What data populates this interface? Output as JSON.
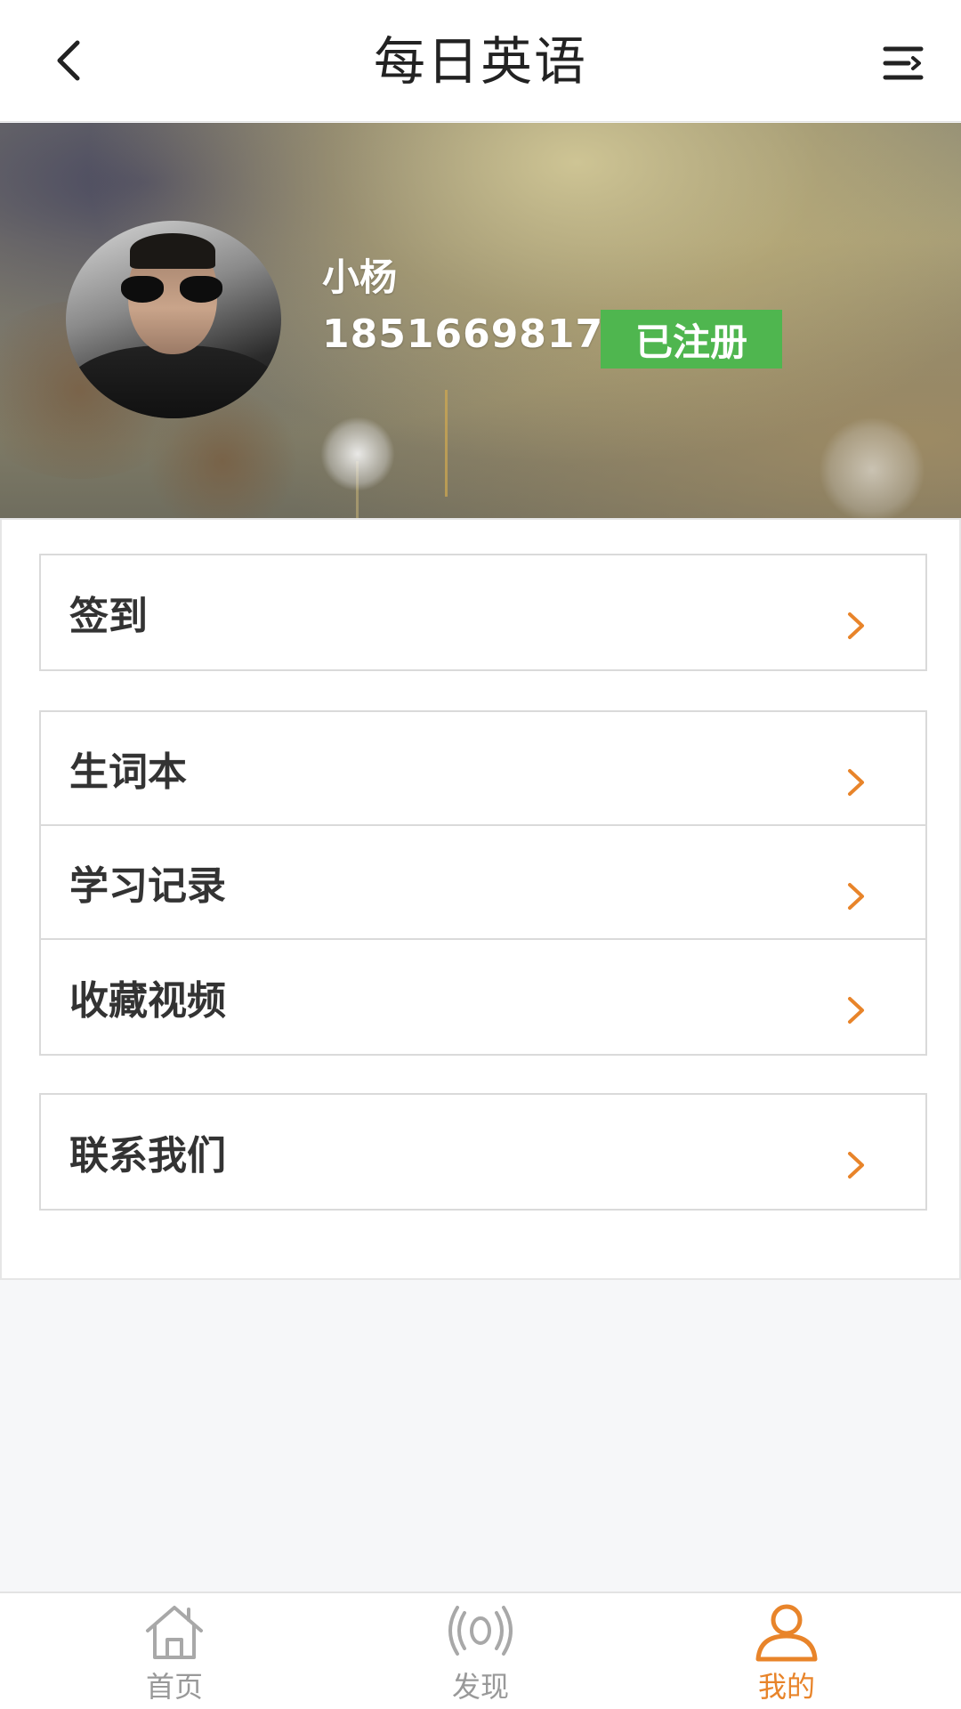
{
  "header": {
    "title": "每日英语",
    "back_icon": "chevron-left-icon",
    "menu_icon": "menu-icon"
  },
  "profile": {
    "name": "小杨",
    "phone": "18516698177",
    "status_badge": "已注册",
    "badge_color": "#4fb64f"
  },
  "menu_groups": [
    {
      "items": [
        {
          "label": "签到"
        }
      ]
    },
    {
      "items": [
        {
          "label": "生词本"
        },
        {
          "label": "学习记录"
        },
        {
          "label": "收藏视频"
        }
      ]
    },
    {
      "items": [
        {
          "label": "联系我们"
        }
      ]
    }
  ],
  "tabbar": {
    "items": [
      {
        "label": "首页",
        "icon": "home-icon",
        "active": false
      },
      {
        "label": "发现",
        "icon": "broadcast-icon",
        "active": false
      },
      {
        "label": "我的",
        "icon": "user-icon",
        "active": true
      }
    ],
    "active_color": "#e8842a",
    "inactive_color": "#999999"
  },
  "accent_color": "#e8842a"
}
